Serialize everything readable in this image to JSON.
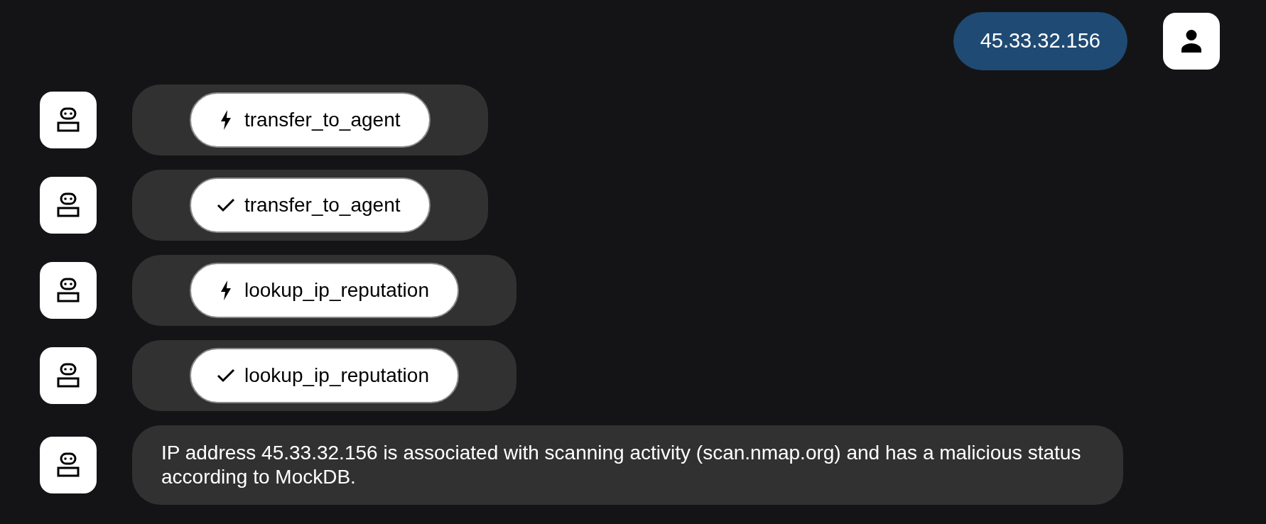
{
  "messages": [
    {
      "kind": "user",
      "text": "45.33.32.156"
    },
    {
      "kind": "tool",
      "done": false,
      "text": "transfer_to_agent"
    },
    {
      "kind": "tool",
      "done": true,
      "text": "transfer_to_agent"
    },
    {
      "kind": "tool",
      "done": false,
      "text": "lookup_ip_reputation"
    },
    {
      "kind": "tool",
      "done": true,
      "text": "lookup_ip_reputation"
    },
    {
      "kind": "reply",
      "text": "IP address 45.33.32.156 is associated with scanning activity (scan.nmap.org) and has a malicious status according to MockDB."
    }
  ]
}
